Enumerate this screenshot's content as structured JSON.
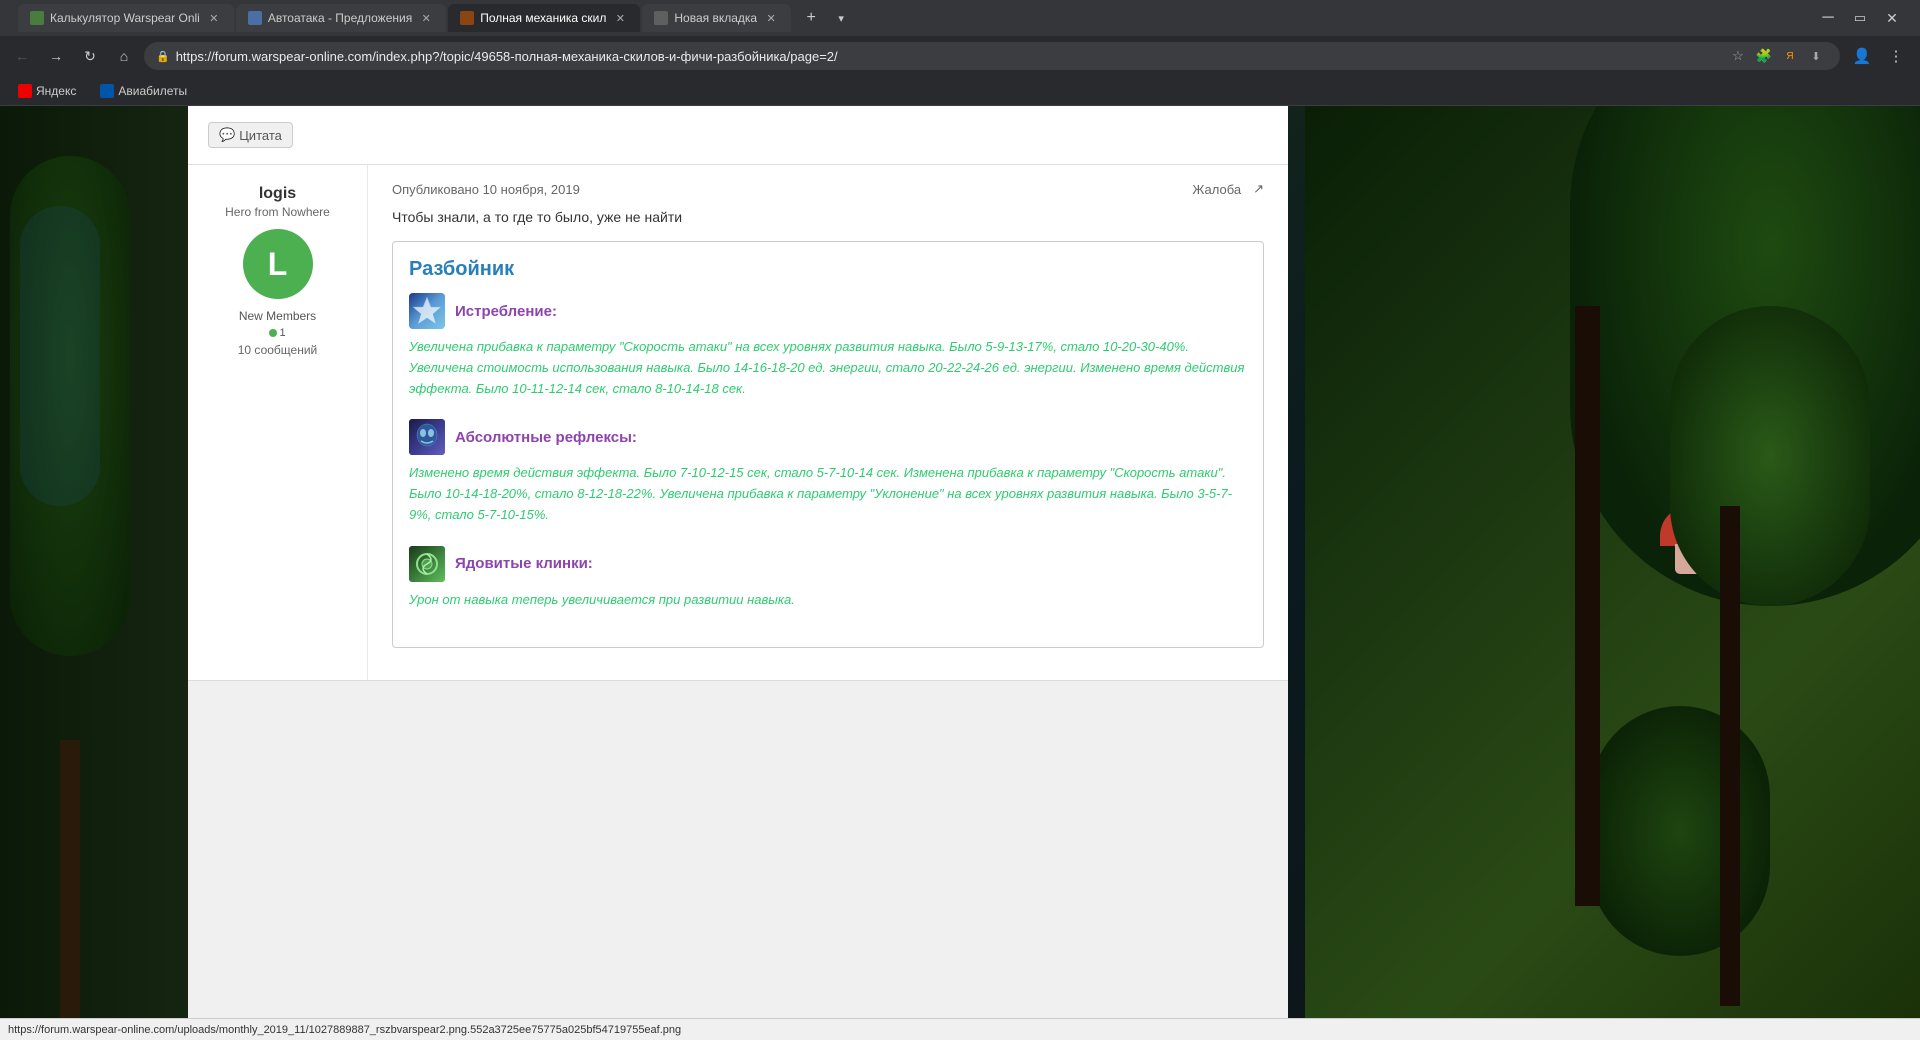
{
  "browser": {
    "tabs": [
      {
        "id": "calc",
        "label": "Калькулятор Warspear Onli",
        "active": false,
        "favicon_color": "#4a7c3f"
      },
      {
        "id": "auto",
        "label": "Автоатака - Предложения",
        "active": false,
        "favicon_color": "#4a6fa5"
      },
      {
        "id": "polnaya",
        "label": "Полная механика скил",
        "active": true,
        "favicon_color": "#8b4513"
      },
      {
        "id": "new",
        "label": "Новая вкладка",
        "active": false,
        "favicon_color": "#5f5f5f"
      }
    ],
    "url": "https://forum.warspear-online.com/index.php?/topic/49658-полная-механика-скилов-и-фичи-разбойника/page=2/",
    "bookmarks": [
      {
        "label": "Яндекс",
        "favicon_color": "#ff0000"
      },
      {
        "label": "Авиабилеты",
        "favicon_color": "#0055aa"
      }
    ]
  },
  "post": {
    "quote_label": "Цитата",
    "user": {
      "name": "logis",
      "title": "Hero from Nowhere",
      "avatar_letter": "L",
      "avatar_color": "#4caf50",
      "role": "New Members",
      "pip_count": "1",
      "post_count": "10 сообщений"
    },
    "published": "Опубликовано 10 ноября, 2019",
    "report_label": "Жалоба",
    "intro_text": "Чтобы знали, а то где то было, уже не найти",
    "class_name": "Разбойник",
    "skills": [
      {
        "id": "extermination",
        "name": "Истребление:",
        "icon_type": "extermination",
        "description": "Увеличена прибавка к параметру \"Скорость атаки\" на всех уровнях развития навыка. Было 5-9-13-17%, стало 10-20-30-40%. Увеличена стоимость использования навыка. Было 14-16-18-20 ед. энергии, стало 20-22-24-26 ед. энергии. Изменено время действия эффекта. Было 10-11-12-14 сек, стало 8-10-14-18 сек."
      },
      {
        "id": "reflexes",
        "name": "Абсолютные рефлексы:",
        "icon_type": "reflexes",
        "description": "Изменено время действия эффекта. Было 7-10-12-15 сек, стало 5-7-10-14 сек. Изменена прибавка к параметру \"Скорость атаки\". Было 10-14-18-20%, стало 8-12-18-22%. Увеличена прибавка к параметру \"Уклонение\" на всех уровнях развития навыка. Было 3-5-7-9%, стало 5-7-10-15%."
      },
      {
        "id": "poison",
        "name": "Ядовитые клинки:",
        "icon_type": "poison",
        "description": "Урон от навыка теперь увеличивается при развитии навыка."
      }
    ]
  },
  "status_bar": {
    "url": "https://forum.warspear-online.com/uploads/monthly_2019_11/1027889887_rszbvarspear2.png.552a3725ee75775a025bf54719755eaf.png"
  }
}
